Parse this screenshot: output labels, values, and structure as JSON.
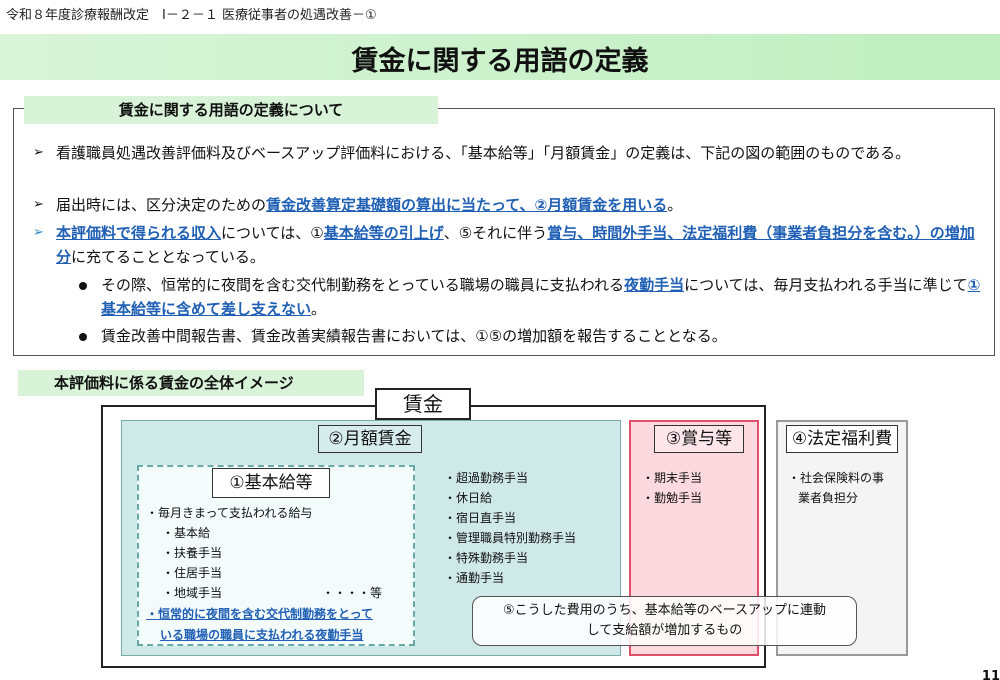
{
  "header": "令和８年度診療報酬改定　Ⅰ－２－１ 医療従事者の処遇改善－①",
  "title": "賃金に関する用語の定義",
  "defs_tab": "賃金に関する用語の定義について",
  "markers": {
    "arrow": "➢"
  },
  "b1": "看護職員処遇改善評価料及びベースアップ評価料における、「基本給等」「月額賃金」の定義は、下記の図の範囲のものである。",
  "b2": {
    "t1": "届出時には、区分決定のための",
    "t2": "賃金改善算定基礎額の算出に当たって、②月額賃金を用いる",
    "t3": "。"
  },
  "b3": {
    "t1": "本評価料で得られる収入",
    "t2": "については、①",
    "t3": "基本給等の引上げ",
    "t4": "、⑤それに伴う",
    "t5": "賞与、時間外手当、法定福利費（事業者負担分を含む。）の増加分",
    "t6": "に充てることとなっている。"
  },
  "s1": {
    "t1": "その際、恒常的に夜間を含む交代制勤務をとっている職場の職員に支払われる",
    "t2": "夜勤手当",
    "t3": "については、毎月支払われる手当に準じて",
    "t4": "①基本給等に含めて差し支えない",
    "t5": "。"
  },
  "s2": "賃金改善中間報告書、賃金改善実績報告書においては、①⑤の増加額を報告することとなる。",
  "image_tab": "本評価料に係る賃金の全体イメージ",
  "diagram": {
    "wage": "賃金",
    "monthly": "②月額賃金",
    "basic": "①基本給等",
    "basic_items": [
      "・毎月きまって支払われる給与",
      "・基本給",
      "・扶養手当",
      "・住居手当",
      "・地域手当"
    ],
    "etc": "・・・・等",
    "night_line1": "・恒常的に夜間を含む交代制勤務をとって",
    "night_line2": "いる職場の職員に支払われる夜勤手当",
    "allowances": [
      "・超過勤務手当",
      "・休日給",
      "・宿日直手当",
      "・管理職員特別勤務手当",
      "・特殊勤務手当",
      "・通勤手当"
    ],
    "bonus": "③賞与等",
    "bonus_items": [
      "・期末手当",
      "・勤勉手当"
    ],
    "legal": "④法定福利費",
    "legal_items": [
      "・社会保険料の事",
      "業者負担分"
    ],
    "note_line1": "⑤こうした費用のうち、基本給等のベースアップに連動",
    "note_line2": "して支給額が増加するもの"
  },
  "page_number": "11"
}
